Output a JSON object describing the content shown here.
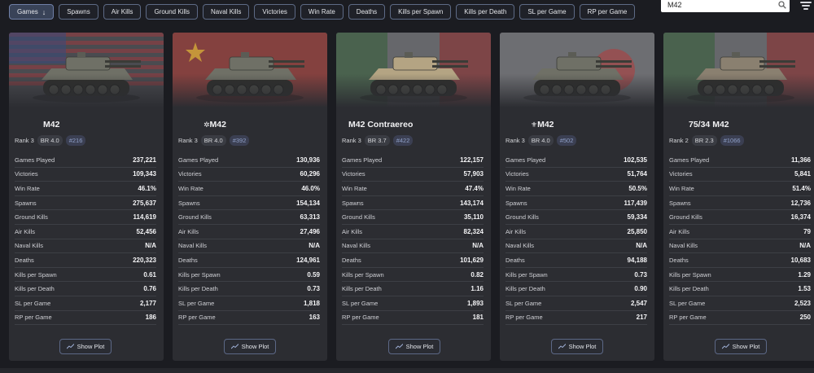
{
  "filters": [
    {
      "label": "Games",
      "active": true
    },
    {
      "label": "Spawns",
      "active": false
    },
    {
      "label": "Air Kills",
      "active": false
    },
    {
      "label": "Ground Kills",
      "active": false
    },
    {
      "label": "Naval Kills",
      "active": false
    },
    {
      "label": "Victories",
      "active": false
    },
    {
      "label": "Win Rate",
      "active": false
    },
    {
      "label": "Deaths",
      "active": false
    },
    {
      "label": "Kills per Spawn",
      "active": false
    },
    {
      "label": "Kills per Death",
      "active": false
    },
    {
      "label": "SL per Game",
      "active": false
    },
    {
      "label": "RP per Game",
      "active": false
    }
  ],
  "sort_icon": "arrow-down-icon",
  "search": {
    "value": "M42",
    "icon": "search-icon"
  },
  "filter_icon": "filter-lines-icon",
  "stat_labels": [
    "Games Played",
    "Victories",
    "Win Rate",
    "Spawns",
    "Ground Kills",
    "Air Kills",
    "Naval Kills",
    "Deaths",
    "Kills per Spawn",
    "Kills per Death",
    "SL per Game",
    "RP per Game"
  ],
  "show_plot_label": "Show Plot",
  "cards": [
    {
      "name": "M42",
      "prefix": "",
      "flag": "usa",
      "flag_colors": [
        "#9a3a3e",
        "#d9d9d9",
        "#3b4a78"
      ],
      "vehicle_color": "#6f7066",
      "rank": "Rank 3",
      "br": "BR 4.0",
      "position": "#216",
      "stats": [
        "237,221",
        "109,343",
        "46.1%",
        "275,637",
        "114,619",
        "52,456",
        "N/A",
        "220,323",
        "0.61",
        "0.76",
        "2,177",
        "186"
      ]
    },
    {
      "name": "M42",
      "prefix": "✲",
      "flag": "china",
      "flag_colors": [
        "#b43a32",
        "#d9b23a"
      ],
      "vehicle_color": "#6f7066",
      "rank": "Rank 3",
      "br": "BR 4.0",
      "position": "#392",
      "stats": [
        "130,936",
        "60,296",
        "46.0%",
        "154,134",
        "63,313",
        "27,496",
        "N/A",
        "124,961",
        "0.59",
        "0.73",
        "1,818",
        "163"
      ]
    },
    {
      "name": "M42 Contraereo",
      "prefix": "",
      "flag": "italy",
      "flag_colors": [
        "#4a7a4c",
        "#d9d9d9",
        "#b0403e"
      ],
      "vehicle_color": "#b4a483",
      "rank": "Rank 3",
      "br": "BR 3.7",
      "position": "#422",
      "stats": [
        "122,157",
        "57,903",
        "47.4%",
        "143,174",
        "35,110",
        "82,324",
        "N/A",
        "101,629",
        "0.82",
        "1.16",
        "1,893",
        "181"
      ]
    },
    {
      "name": "M42",
      "prefix": "⚜",
      "flag": "japan",
      "flag_colors": [
        "#d8d8d8",
        "#b53a3a"
      ],
      "vehicle_color": "#6f7066",
      "rank": "Rank 3",
      "br": "BR 4.0",
      "position": "#502",
      "stats": [
        "102,535",
        "51,764",
        "50.5%",
        "117,439",
        "59,334",
        "25,850",
        "N/A",
        "94,188",
        "0.73",
        "0.90",
        "2,547",
        "217"
      ]
    },
    {
      "name": "75/34 M42",
      "prefix": "",
      "flag": "italy",
      "flag_colors": [
        "#4a7a4c",
        "#d9d9d9",
        "#b0403e"
      ],
      "vehicle_color": "#8a8070",
      "rank": "Rank 2",
      "br": "BR 2.3",
      "position": "#1066",
      "stats": [
        "11,366",
        "5,841",
        "51.4%",
        "12,736",
        "16,374",
        "79",
        "N/A",
        "10,683",
        "1.29",
        "1.53",
        "2,523",
        "250"
      ]
    }
  ]
}
